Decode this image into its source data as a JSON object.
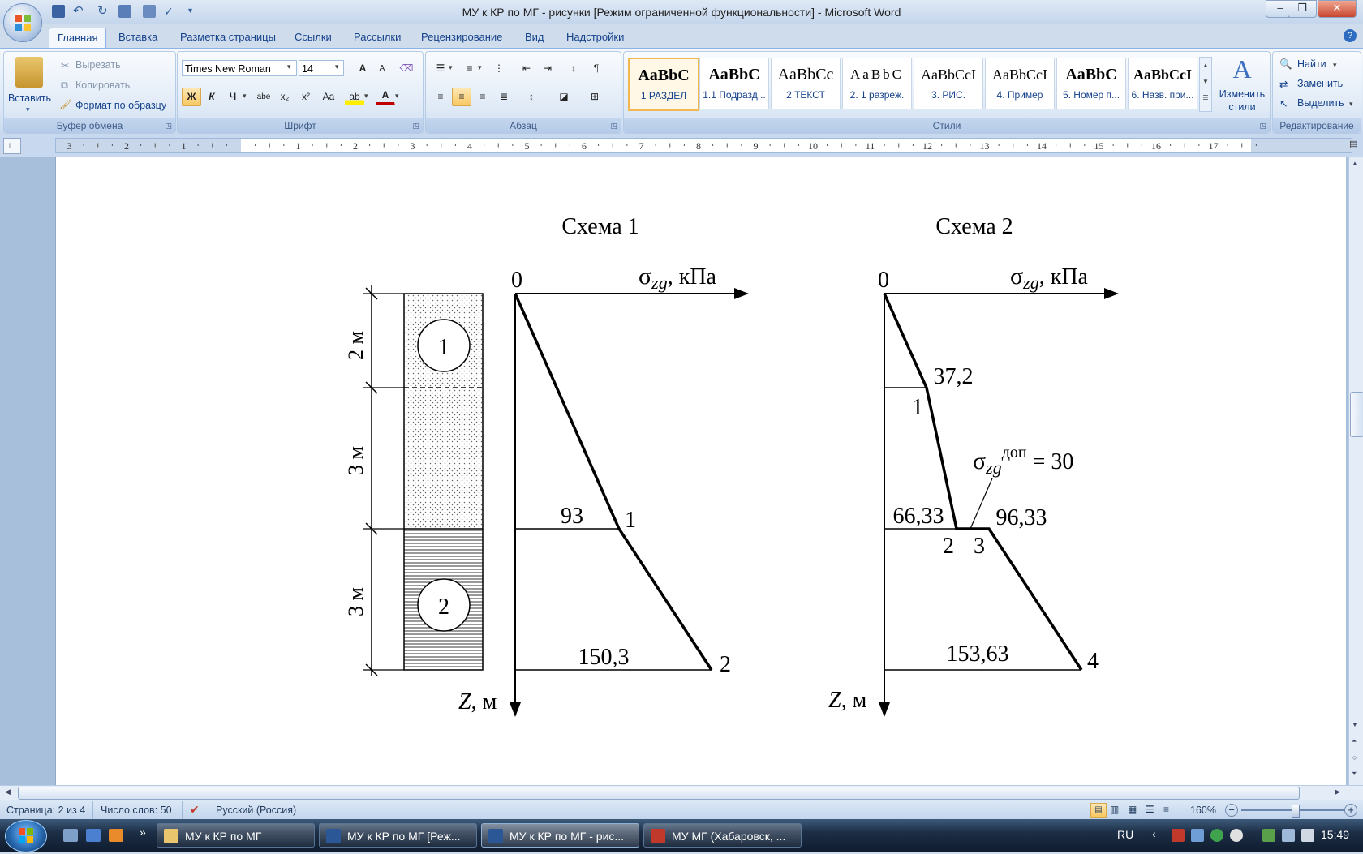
{
  "window": {
    "title": "МУ к КР по МГ - рисунки [Режим ограниченной функциональности] - Microsoft Word",
    "minimize": "–",
    "maximize": "❐",
    "close": "✕"
  },
  "tabs": [
    "Главная",
    "Вставка",
    "Разметка страницы",
    "Ссылки",
    "Рассылки",
    "Рецензирование",
    "Вид",
    "Надстройки"
  ],
  "ribbon": {
    "clipboard": {
      "paste": "Вставить",
      "cut": "Вырезать",
      "copy": "Копировать",
      "format_painter": "Формат по образцу",
      "label": "Буфер обмена"
    },
    "font": {
      "name": "Times New Roman",
      "size": "14",
      "grow": "A",
      "shrink": "A",
      "bold": "Ж",
      "italic": "К",
      "underline": "Ч",
      "strike": "abe",
      "subscript": "x₂",
      "superscript": "x²",
      "change_case": "Aa",
      "highlight": "ab",
      "font_color": "A",
      "label": "Шрифт"
    },
    "paragraph": {
      "label": "Абзац",
      "pilcrow": "¶"
    },
    "styles": {
      "items": [
        {
          "preview": "AaBbC",
          "name": "1 РАЗДЕЛ"
        },
        {
          "preview": "AaBbC",
          "name": "1.1 Подразд..."
        },
        {
          "preview": "AaBbCc",
          "name": "2 ТЕКСТ"
        },
        {
          "preview": "AaBbC",
          "name": "2. 1 разреж."
        },
        {
          "preview": "AaBbCcI",
          "name": "3. РИС."
        },
        {
          "preview": "AaBbCcI",
          "name": "4. Пример"
        },
        {
          "preview": "AaBbC",
          "name": "5. Номер п..."
        },
        {
          "preview": "AaBbCcI",
          "name": "6. Назв. при..."
        }
      ],
      "change_styles": "Изменить стили",
      "label": "Стили"
    },
    "editing": {
      "find": "Найти",
      "replace": "Заменить",
      "select": "Выделить",
      "label": "Редактирование"
    }
  },
  "ruler_numbers": [
    "3",
    "2",
    "1",
    "1",
    "2",
    "3",
    "4",
    "5",
    "6",
    "7",
    "8",
    "9",
    "10",
    "11",
    "12",
    "13",
    "14",
    "15",
    "16",
    "17"
  ],
  "figure": {
    "scheme1": {
      "title": "Схема 1",
      "layer_thickness": [
        "2 м",
        "3 м",
        "3 м"
      ],
      "layers": [
        "1",
        "2"
      ],
      "origin": "0",
      "axis_x": "σ",
      "axis_x_sub": "zg",
      "axis_x_unit": ", кПа",
      "axis_z": "Z",
      "axis_z_unit": ", м",
      "values": [
        "93",
        "150,3"
      ],
      "points": [
        "1",
        "2"
      ]
    },
    "scheme2": {
      "title": "Схема 2",
      "origin": "0",
      "axis_x": "σ",
      "axis_x_sub": "zg",
      "axis_x_unit": ", кПа",
      "axis_z": "Z",
      "axis_z_unit": ", м",
      "values": [
        "37,2",
        "66,33",
        "96,33",
        "153,63"
      ],
      "points": [
        "1",
        "2",
        "3",
        "4"
      ],
      "annotation_symbol": "σ",
      "annotation_sub": "zg",
      "annotation_sup": "доп",
      "annotation_value": " = 30"
    }
  },
  "statusbar": {
    "page": "Страница: 2 из 4",
    "words": "Число слов: 50",
    "language": "Русский (Россия)",
    "zoom": "160%"
  },
  "taskbar": {
    "buttons": [
      {
        "label": "МУ к КР по МГ"
      },
      {
        "label": "МУ к КР по МГ [Реж..."
      },
      {
        "label": "МУ к КР по МГ - рис..."
      },
      {
        "label": "МУ МГ (Хабаровск, ..."
      }
    ],
    "lang": "RU",
    "time": "15:49"
  }
}
